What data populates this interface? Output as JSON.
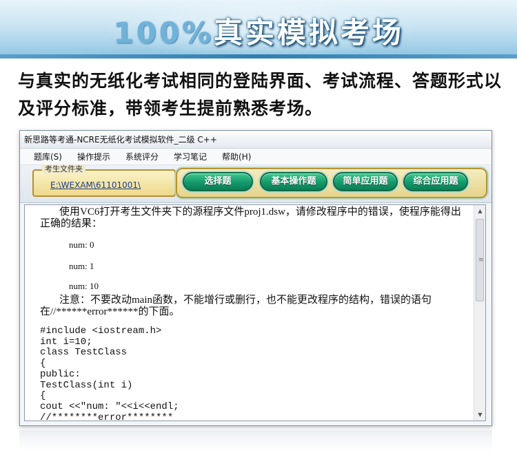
{
  "banner": {
    "title_prefix": "100%",
    "title_main": "真实模拟考场"
  },
  "description": "与真实的无纸化考试相同的登陆界面、考试流程、答题形式以及评分标准，带领考生提前熟悉考场。",
  "window": {
    "title": "新思路等考通-NCRE无纸化考试模拟软件_二级 C++"
  },
  "menu": {
    "items": [
      "题库(S)",
      "操作提示",
      "系统评分",
      "学习笔记",
      "帮助(H)"
    ]
  },
  "folder": {
    "caption": "考生文件夹",
    "path": "E:\\WEXAM\\61101001\\"
  },
  "tabs": {
    "items": [
      "选择题",
      "基本操作题",
      "简单应用题",
      "综合应用题"
    ]
  },
  "content": {
    "instruction": "使用VC6打开考生文件夹下的源程序文件proj1.dsw，请修改程序中的错误，使程序能得出正确的结果：",
    "outputs": [
      "num: 0",
      "num: 1",
      "num: 10"
    ],
    "note": "注意：不要改动main函数，不能增行或删行，也不能更改程序的结构，错误的语句在//******error******的下面。",
    "code_lines": [
      "#include <iostream.h>",
      "int i=10;",
      "class TestClass",
      "{",
      "public:",
      "TestClass(int i)",
      "{",
      "cout <<\"num: \"<<i<<endl;",
      "//********error********"
    ]
  }
}
